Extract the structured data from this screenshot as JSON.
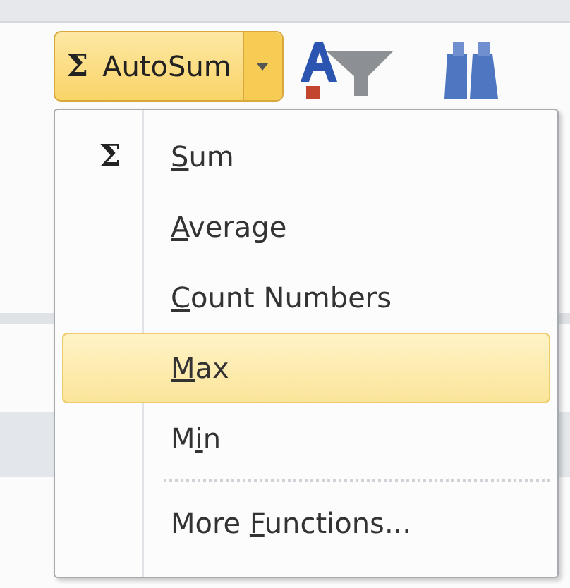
{
  "ribbon": {
    "autosum_button": {
      "symbol": "Σ",
      "label": "AutoSum",
      "pressed": true
    }
  },
  "menu": {
    "items": [
      {
        "kind": "item",
        "icon": "Σ",
        "key": "S",
        "after": "um",
        "selected": false
      },
      {
        "kind": "item",
        "key": "A",
        "after": "verage",
        "selected": false
      },
      {
        "kind": "item",
        "key": "C",
        "after": "ount Numbers",
        "selected": false
      },
      {
        "kind": "item",
        "key": "M",
        "after": "ax",
        "selected": true
      },
      {
        "kind": "item",
        "before": "M",
        "key": "i",
        "after": "n",
        "selected": false
      },
      {
        "kind": "separator"
      },
      {
        "kind": "item",
        "before": "More ",
        "key": "F",
        "after": "unctions...",
        "selected": false
      }
    ]
  }
}
